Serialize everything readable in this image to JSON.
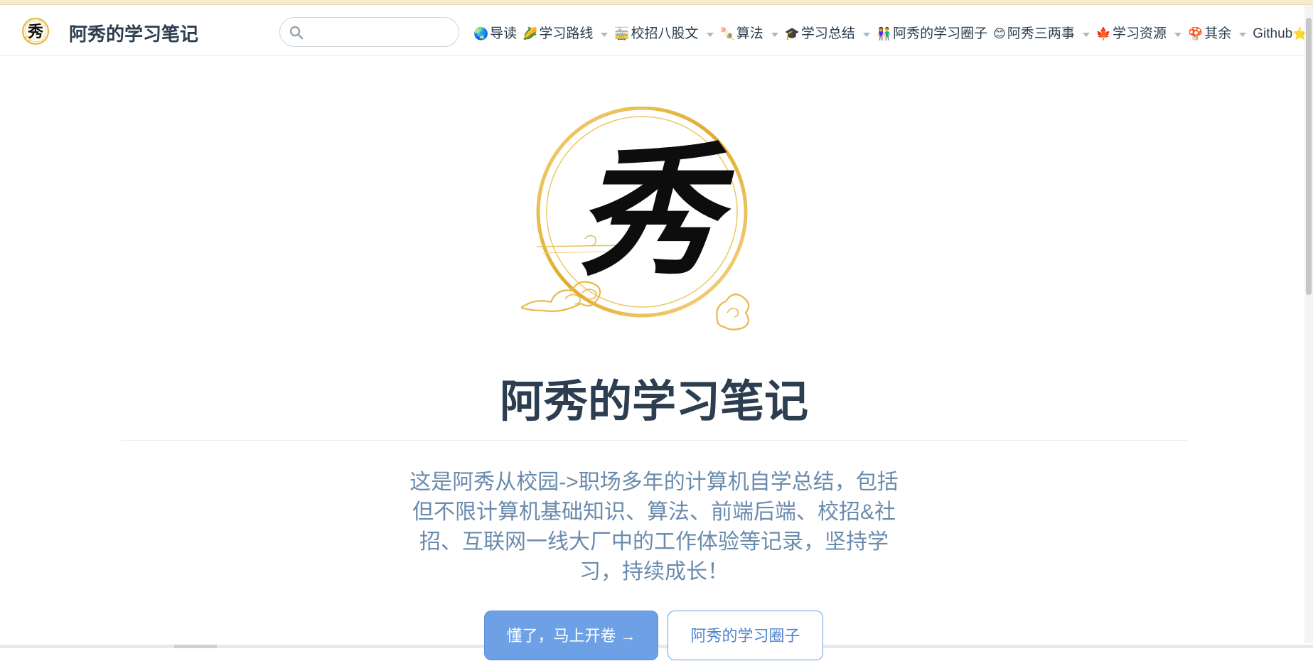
{
  "site": {
    "title": "阿秀的学习笔记",
    "logo_glyph": "秀"
  },
  "search": {
    "placeholder": "",
    "value": ""
  },
  "nav": {
    "items": [
      {
        "emoji": "🌏",
        "label": "导读",
        "dropdown": false
      },
      {
        "emoji": "🌽",
        "label": "学习路线",
        "dropdown": true
      },
      {
        "emoji": "🚋",
        "label": "校招八股文",
        "dropdown": true
      },
      {
        "emoji": "🍡",
        "label": "算法",
        "dropdown": true
      },
      {
        "emoji": "🎓",
        "label": "学习总结",
        "dropdown": true
      },
      {
        "emoji": "👫",
        "label": "阿秀的学习圈子",
        "dropdown": false
      },
      {
        "emoji": "😊",
        "label": "阿秀三两事",
        "dropdown": true
      },
      {
        "emoji": "🍁",
        "label": "学习资源",
        "dropdown": true
      },
      {
        "emoji": "🍄",
        "label": "其余",
        "dropdown": true
      },
      {
        "emoji": "⭐",
        "label": "Github",
        "dropdown": false,
        "external": true
      }
    ]
  },
  "hero": {
    "logo_glyph": "秀",
    "title": "阿秀的学习笔记",
    "description": "这是阿秀从校园->职场多年的计算机自学总结，包括但不限计算机基础知识、算法、前端后端、校招&社招、互联网一线大厂中的工作体验等记录，坚持学习，持续成长！",
    "primary_action": "懂了，马上开卷 →",
    "secondary_action": "阿秀的学习圈子"
  },
  "colors": {
    "text": "#2c3e50",
    "description": "#6a8bad",
    "accent": "#6ea0e6",
    "gold": "#e0b43a"
  }
}
